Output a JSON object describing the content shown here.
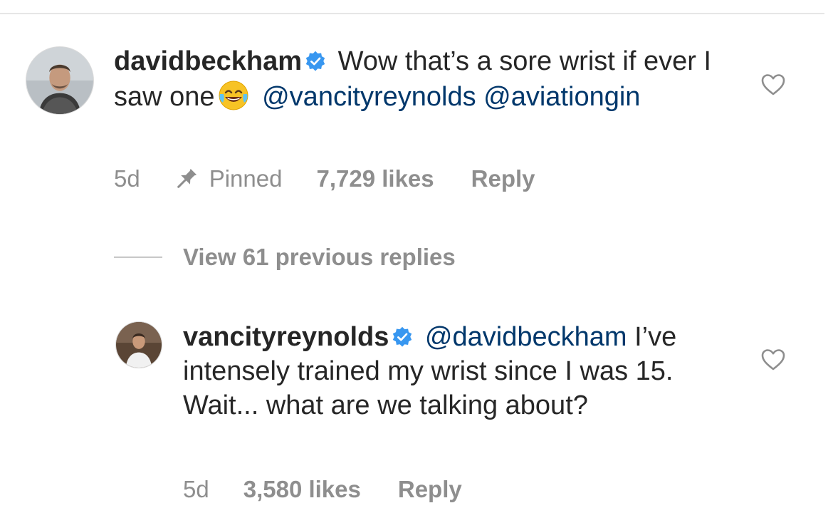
{
  "comment": {
    "avatar_alt": "davidbeckham profile picture",
    "username": "davidbeckham",
    "verified_icon": "verified-badge-icon",
    "text_part1": "Wow that’s a sore wrist if ever I saw one",
    "emoji": "face-with-tears-of-joy",
    "mentions": [
      "@vancityreynolds",
      "@aviationgin"
    ],
    "time": "5d",
    "pinned_label": "Pinned",
    "likes": "7,729 likes",
    "reply_label": "Reply",
    "like_icon": "heart-outline-icon"
  },
  "view_replies": {
    "label": "View 61 previous replies"
  },
  "reply": {
    "avatar_alt": "vancityreynolds profile picture",
    "username": "vancityreynolds",
    "verified_icon": "verified-badge-icon",
    "mention": "@davidbeckham",
    "text": "I’ve intensely trained my wrist since I was 15. Wait... what are we talking about?",
    "time": "5d",
    "likes": "3,580 likes",
    "reply_label": "Reply",
    "like_icon": "heart-outline-icon"
  },
  "colors": {
    "text": "#262626",
    "mention": "#00376b",
    "meta": "#8e8e8e",
    "verified": "#3897f0"
  }
}
